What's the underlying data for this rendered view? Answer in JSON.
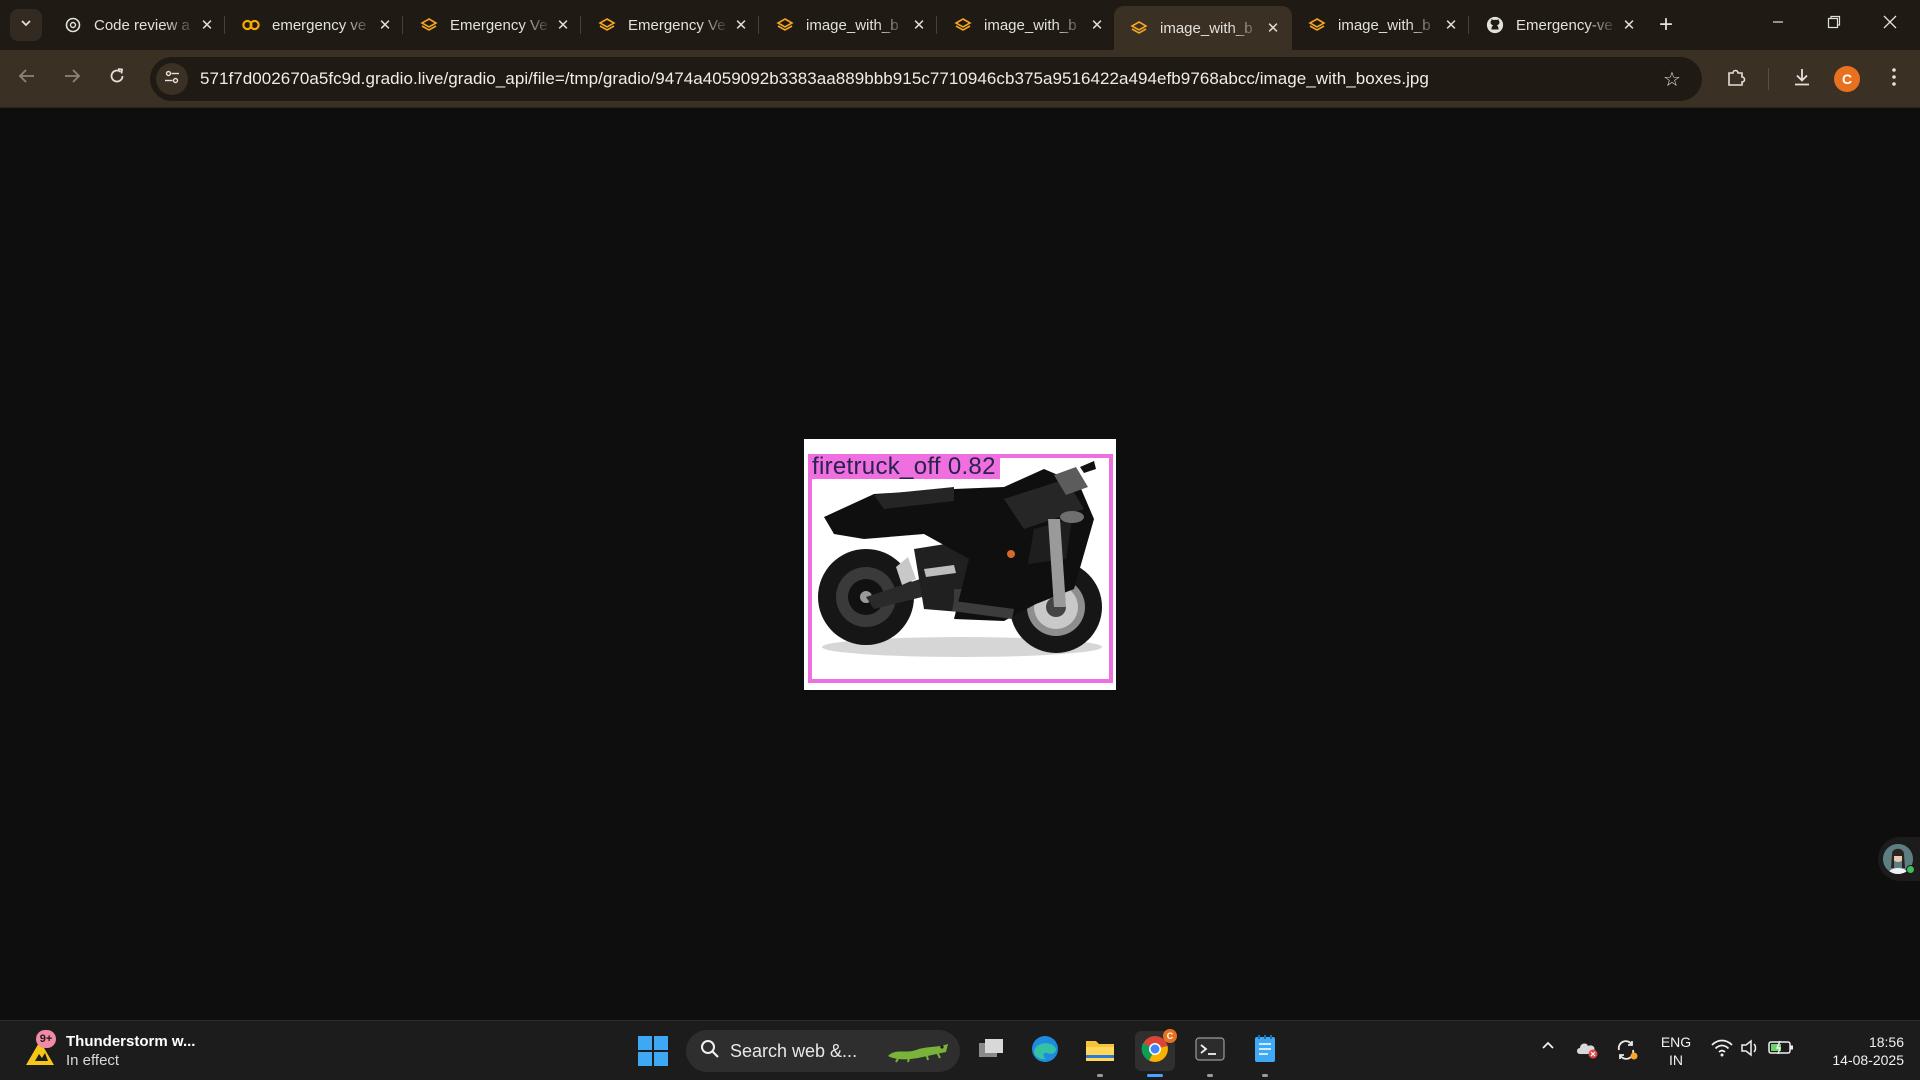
{
  "browser": {
    "tabs": [
      {
        "title": "Code review a",
        "icon": "openai-icon",
        "active": false
      },
      {
        "title": "emergency ve",
        "icon": "colab-icon",
        "active": false
      },
      {
        "title": "Emergency Ve",
        "icon": "layers-icon",
        "active": false
      },
      {
        "title": "Emergency Ve",
        "icon": "layers-icon",
        "active": false
      },
      {
        "title": "image_with_b",
        "icon": "layers-icon",
        "active": false
      },
      {
        "title": "image_with_b",
        "icon": "layers-icon",
        "active": false
      },
      {
        "title": "image_with_b",
        "icon": "layers-icon",
        "active": true
      },
      {
        "title": "image_with_b",
        "icon": "layers-icon",
        "active": false
      },
      {
        "title": "Emergency-ve",
        "icon": "github-icon",
        "active": false
      }
    ],
    "url": "571f7d002670a5fc9d.gradio.live/gradio_api/file=/tmp/gradio/9474a4059092b3383aa889bbb915c7710946cb375a9516422a494efb9768abcc/image_with_boxes.jpg",
    "profile_initial": "C",
    "accent_color": "#e8711f"
  },
  "content": {
    "detection_label": "firetruck_off  0.82",
    "box_color": "#ef6ee0"
  },
  "taskbar": {
    "weather_title": "Thunderstorm w...",
    "weather_subtitle": "In effect",
    "weather_badge": "9+",
    "search_label": "Search web &...",
    "lang_line1": "ENG",
    "lang_line2": "IN",
    "time": "18:56",
    "date": "14-08-2025"
  }
}
